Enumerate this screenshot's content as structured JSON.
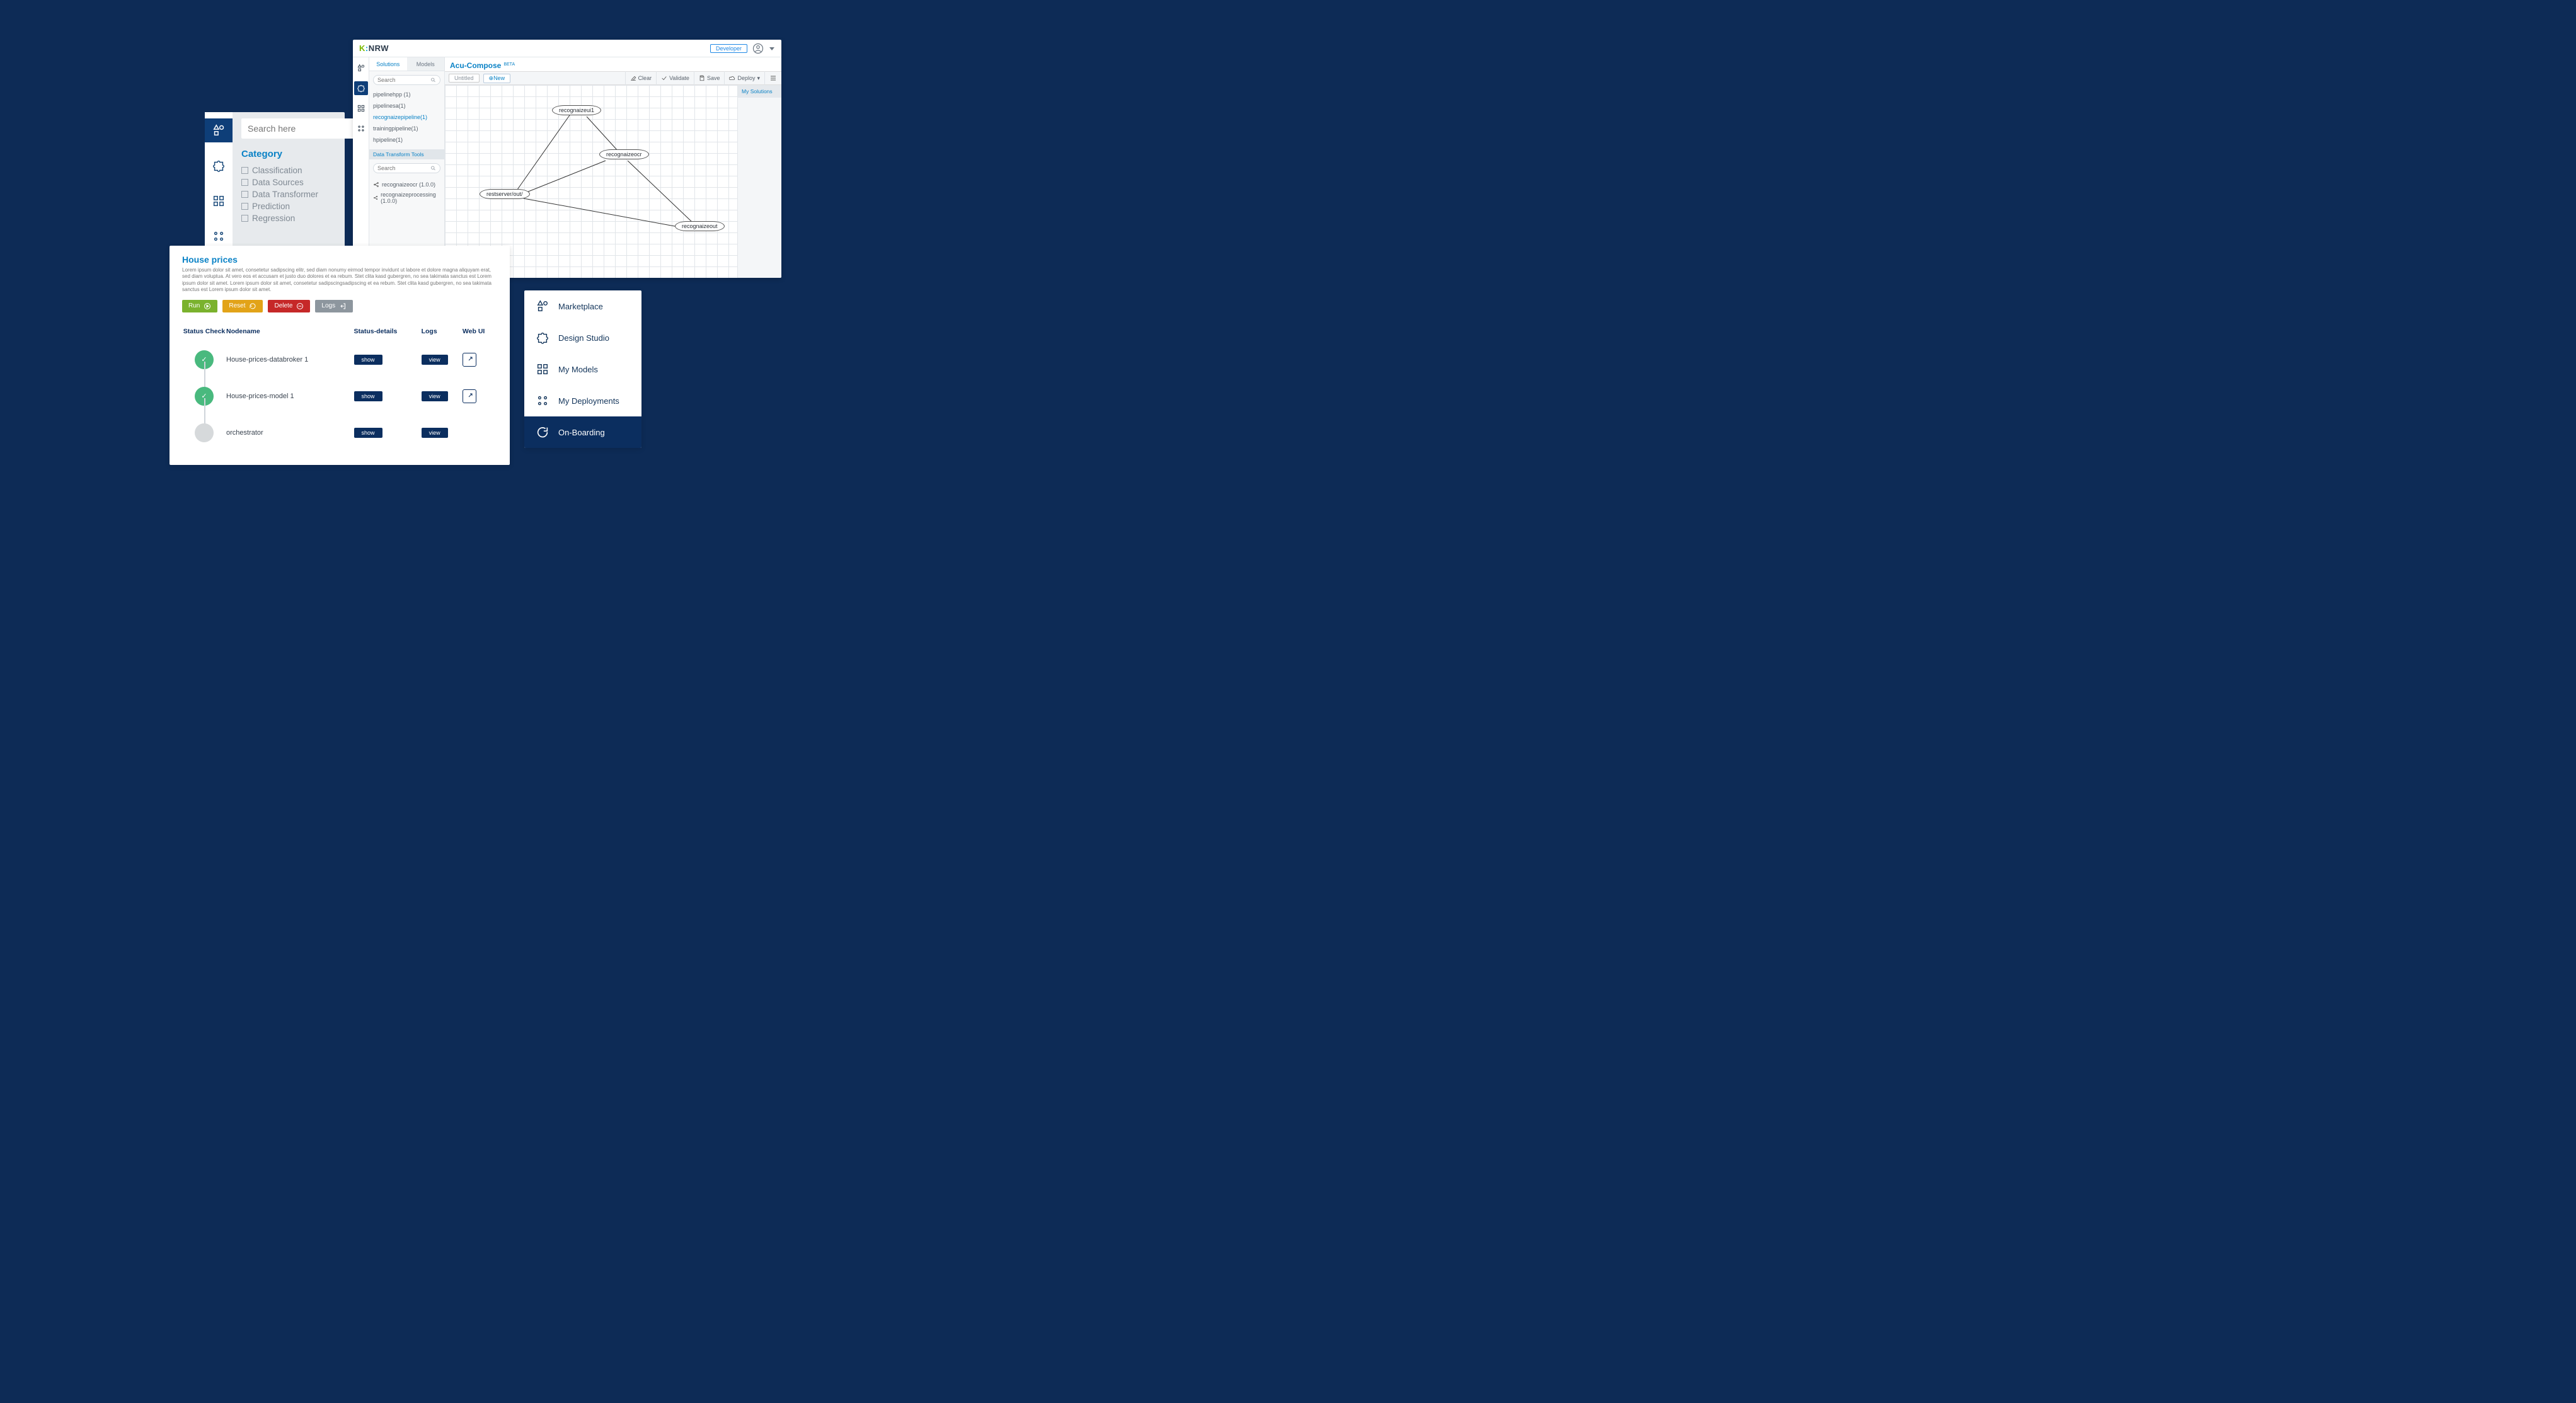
{
  "filter_panel": {
    "search_placeholder": "Search here",
    "category_title": "Category",
    "categories": [
      "Classification",
      "Data Sources",
      "Data Transformer",
      "Prediction",
      "Regression"
    ]
  },
  "studio_panel": {
    "brand": "K:NRW",
    "developer_badge": "Developer",
    "tabs": {
      "solutions": "Solutions",
      "models": "Models"
    },
    "left_search_placeholder": "Search",
    "pipelines": [
      "pipelinehpp (1)",
      "pipelinesa(1)",
      "recognaizepipeline(1)",
      "trainingpipeline(1)",
      "hpipeline(1)"
    ],
    "pipelines_selected_index": 2,
    "tools_header": "Data Transform Tools",
    "tools_search_placeholder": "Search",
    "tools": [
      "recognaizeocr (1.0.0)",
      "recognaizeprocessing (1.0.0)"
    ],
    "canvas_title": "Acu-Compose",
    "canvas_beta": "BETA",
    "toolbar": {
      "untitled": "Untitled",
      "new": "New",
      "clear": "Clear",
      "validate": "Validate",
      "save": "Save",
      "deploy": "Deploy"
    },
    "right_header": "My Solutions",
    "nodes": {
      "n1": "recognaizeui1",
      "n2": "recognaizeocr",
      "n3": "restserver/out/",
      "n4": "recognaizeout"
    }
  },
  "status_panel": {
    "title": "House prices",
    "desc": "Lorem ipsum dolor sit amet, consetetur sadipscing elitr, sed diam nonumy eirmod tempor invidunt ut labore et dolore magna aliquyam erat, sed diam voluptua. At vero eos et accusam et justo duo dolores et ea rebum. Stet clita kasd gubergren, no sea takimata sanctus est Lorem ipsum dolor sit amet. Lorem ipsum dolor sit amet, consetetur sadipscingsadipscing et ea rebum. Stet clita kasd gubergren, no sea takimata sanctus est Lorem ipsum dolor sit amet.",
    "buttons": {
      "run": "Run",
      "reset": "Reset",
      "delete": "Delete",
      "logs": "Logs"
    },
    "columns": {
      "status": "Status Check",
      "nodename": "Nodename",
      "details": "Status-details",
      "logs": "Logs",
      "webui": "Web UI"
    },
    "rows": [
      {
        "status": "ok",
        "name": "House-prices-databroker 1",
        "details": "show",
        "logs": "view",
        "webui": true
      },
      {
        "status": "ok",
        "name": "House-prices-model 1",
        "details": "show",
        "logs": "view",
        "webui": true
      },
      {
        "status": "pending",
        "name": "orchestrator",
        "details": "show",
        "logs": "view",
        "webui": false
      }
    ]
  },
  "nav_panel": {
    "items": [
      "Marketplace",
      "Design Studio",
      "My Models",
      "My Deployments",
      "On-Boarding"
    ],
    "active_index": 4
  }
}
